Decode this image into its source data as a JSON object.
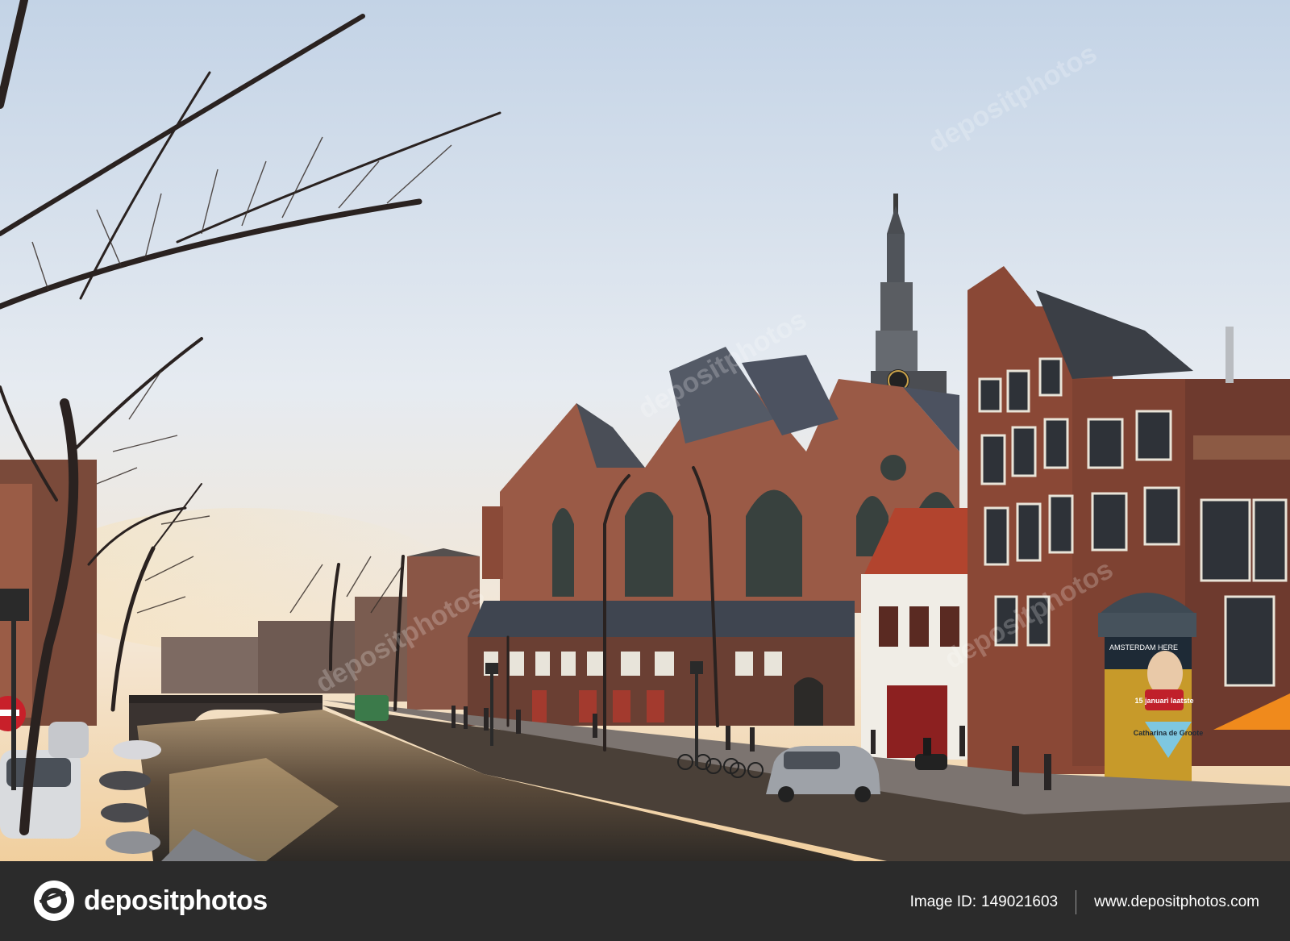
{
  "photo": {
    "scene": "canal-church-street",
    "sign_text": "15 januari laatste",
    "poster_title": "Catharina de Groote",
    "poster_header": "AMSTERDAM HERE",
    "watermark": "depositphotos"
  },
  "footer": {
    "brand": "depositphotos",
    "image_id_label": "Image ID:",
    "image_id": "149021603",
    "site_url": "www.depositphotos.com"
  },
  "colors": {
    "footer_bg": "#2b2b2b",
    "sky_top": "#c9d6e6",
    "sky_bottom": "#f3e3c9",
    "brick": "#8a4a38"
  },
  "icons": {
    "logo": "camera-aperture-icon"
  }
}
